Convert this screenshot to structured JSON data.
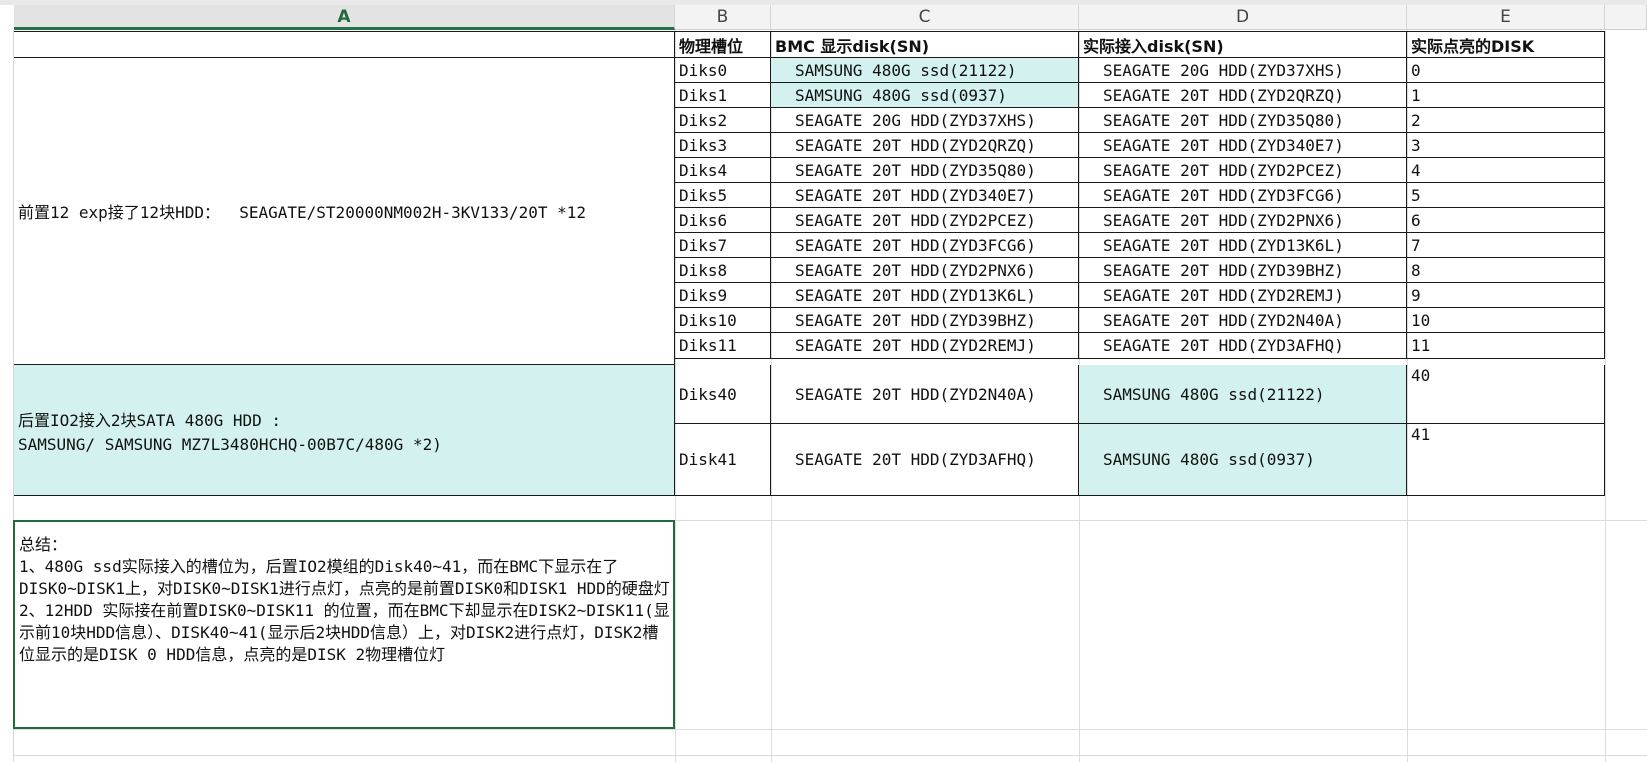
{
  "columns": [
    "A",
    "B",
    "C",
    "D",
    "E"
  ],
  "headers": {
    "slot": "物理槽位",
    "bmc": "BMC 显示disk(SN)",
    "actual": "实际接入disk(SN)",
    "lit": "实际点亮的DISK"
  },
  "groups": {
    "front": "前置12 exp接了12块HDD：  SEAGATE/ST20000NM002H-3KV133/20T *12",
    "rear_line1": "后置IO2接入2块SATA 480G HDD :",
    "rear_line2": "SAMSUNG/ SAMSUNG MZ7L3480HCHQ-00B7C/480G *2)"
  },
  "rows": [
    {
      "slot": "Diks0",
      "bmc": "SAMSUNG 480G ssd(21122)",
      "actual": "SEAGATE 20G HDD(ZYD37XHS)",
      "lit": "0"
    },
    {
      "slot": "Diks1",
      "bmc": "SAMSUNG 480G ssd(0937)",
      "actual": "SEAGATE 20T HDD(ZYD2QRZQ)",
      "lit": "1"
    },
    {
      "slot": "Diks2",
      "bmc": "SEAGATE 20G HDD(ZYD37XHS)",
      "actual": "SEAGATE 20T HDD(ZYD35Q80)",
      "lit": "2"
    },
    {
      "slot": "Diks3",
      "bmc": "SEAGATE 20T HDD(ZYD2QRZQ)",
      "actual": "SEAGATE 20T HDD(ZYD340E7)",
      "lit": "3"
    },
    {
      "slot": "Diks4",
      "bmc": "SEAGATE 20T HDD(ZYD35Q80)",
      "actual": "SEAGATE 20T HDD(ZYD2PCEZ)",
      "lit": "4"
    },
    {
      "slot": "Diks5",
      "bmc": "SEAGATE 20T HDD(ZYD340E7)",
      "actual": "SEAGATE 20T HDD(ZYD3FCG6)",
      "lit": "5"
    },
    {
      "slot": "Diks6",
      "bmc": "SEAGATE 20T HDD(ZYD2PCEZ)",
      "actual": "SEAGATE 20T HDD(ZYD2PNX6)",
      "lit": "6"
    },
    {
      "slot": "Diks7",
      "bmc": "SEAGATE 20T HDD(ZYD3FCG6)",
      "actual": "SEAGATE 20T HDD(ZYD13K6L)",
      "lit": "7"
    },
    {
      "slot": "Diks8",
      "bmc": "SEAGATE 20T HDD(ZYD2PNX6)",
      "actual": "SEAGATE 20T HDD(ZYD39BHZ)",
      "lit": "8"
    },
    {
      "slot": "Diks9",
      "bmc": "SEAGATE 20T HDD(ZYD13K6L)",
      "actual": "SEAGATE 20T HDD(ZYD2REMJ)",
      "lit": "9"
    },
    {
      "slot": "Diks10",
      "bmc": "SEAGATE 20T HDD(ZYD39BHZ)",
      "actual": "SEAGATE 20T HDD(ZYD2N40A)",
      "lit": "10"
    },
    {
      "slot": "Diks11",
      "bmc": "SEAGATE 20T HDD(ZYD2REMJ)",
      "actual": "SEAGATE 20T HDD(ZYD3AFHQ)",
      "lit": "11"
    },
    {
      "slot": "Diks40",
      "bmc": "SEAGATE 20T HDD(ZYD2N40A)",
      "actual": "SAMSUNG 480G ssd(21122)",
      "lit": "40"
    },
    {
      "slot": "Disk41",
      "bmc": "SEAGATE 20T HDD(ZYD3AFHQ)",
      "actual": "SAMSUNG 480G ssd(0937)",
      "lit": "41"
    }
  ],
  "summary": {
    "title": "总结：",
    "p1": "1、480G ssd实际接入的槽位为，后置IO2模组的Disk40~41，而在BMC下显示在了DISK0~DISK1上，对DISK0~DISK1进行点灯，点亮的是前置DISK0和DISK1 HDD的硬盘灯",
    "p2": "2、12HDD 实际接在前置DISK0~DISK11 的位置，而在BMC下却显示在DISK2~DISK11(显示前10块HDD信息）、DISK40~41(显示后2块HDD信息）上，对DISK2进行点灯，DISK2槽位显示的是DISK 0 HDD信息，点亮的是DISK 2物理槽位灯"
  },
  "colors": {
    "teal": "#d3f2ef",
    "selection": "#1f6b3a"
  }
}
